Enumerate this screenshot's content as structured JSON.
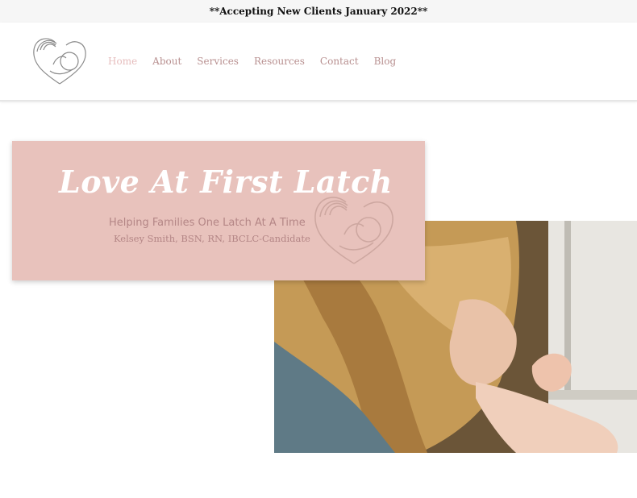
{
  "announcement": "**Accepting New Clients January 2022**",
  "nav": {
    "items": [
      {
        "label": "Home",
        "active": true
      },
      {
        "label": "About"
      },
      {
        "label": "Services"
      },
      {
        "label": "Resources"
      },
      {
        "label": "Contact"
      },
      {
        "label": "Blog"
      }
    ]
  },
  "hero": {
    "title": "Love At First Latch",
    "subtitle": "Helping Families One Latch At A Time",
    "credentials": "Kelsey Smith, BSN, RN, IBCLC-Candidate"
  },
  "colors": {
    "brand_pink": "#e8c2bc",
    "nav_text": "#b89090",
    "nav_active": "#e6bdbd",
    "subtitle_text": "#b48686"
  },
  "icons": {
    "logo": "mother-baby-heart-logo",
    "hero_logo": "mother-baby-heart-logo"
  }
}
